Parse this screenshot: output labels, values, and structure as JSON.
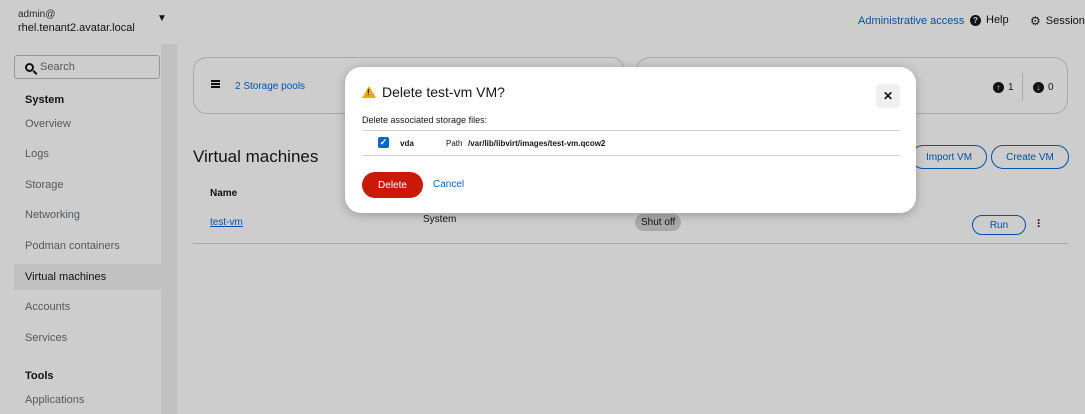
{
  "header": {
    "user": "admin@",
    "host": "rhel.tenant2.avatar.local",
    "admin_access": "Administrative access",
    "help": "Help",
    "session": "Session"
  },
  "sidebar": {
    "search_placeholder": "Search",
    "section_system": "System",
    "items": [
      "Overview",
      "Logs",
      "Storage",
      "Networking",
      "Podman containers",
      "Virtual machines",
      "Accounts",
      "Services"
    ],
    "active_item": "Virtual machines",
    "section_tools": "Tools",
    "tools_items": [
      "Applications"
    ]
  },
  "main": {
    "storage_pools": "2 Storage pools",
    "networks_up": "1",
    "networks_down": "0",
    "title": "Virtual machines",
    "import_label": "Import VM",
    "create_label": "Create VM",
    "column_name": "Name",
    "vm_row": {
      "name": "test-vm",
      "connection": "System",
      "state": "Shut off",
      "run_label": "Run"
    }
  },
  "modal": {
    "title": "Delete test-vm VM?",
    "subtitle": "Delete associated storage files:",
    "disk": {
      "checked": true,
      "name": "vda",
      "path_label": "Path",
      "path": "/var/lib/libvirt/images/test-vm.qcow2"
    },
    "delete_label": "Delete",
    "cancel_label": "Cancel"
  },
  "colors": {
    "accent": "#0066cc",
    "danger": "#c9190b",
    "warning": "#f0ab00"
  }
}
